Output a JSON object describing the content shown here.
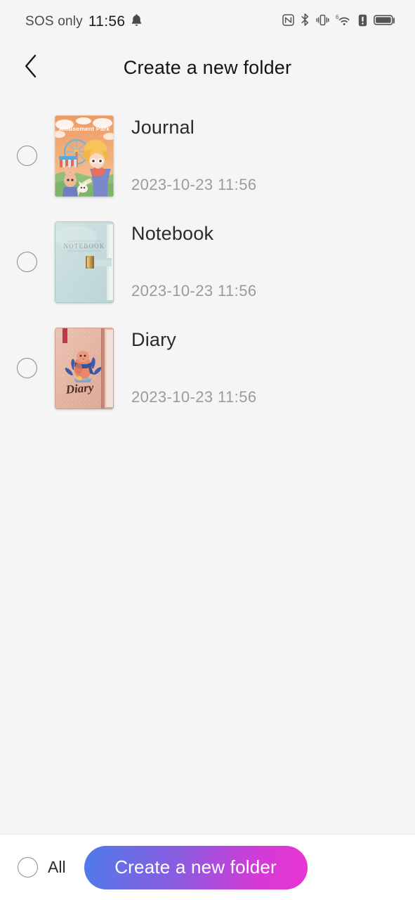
{
  "statusbar": {
    "carrier": "SOS only",
    "time": "11:56",
    "icons_left": [
      "bell-icon"
    ],
    "icons_right": [
      "nfc-icon",
      "bluetooth-icon",
      "vibrate-icon",
      "wifi-6-icon",
      "alert-icon",
      "battery-icon"
    ],
    "wifi_generation": "6"
  },
  "header": {
    "back_icon": "chevron-left-icon",
    "title": "Create a new folder"
  },
  "list": {
    "items": [
      {
        "title": "Journal",
        "date": "2023-10-23 11:56",
        "selected": false,
        "cover": {
          "name": "amusement-park-cover",
          "caption": "Amusement Park",
          "sky": "#f0a06a",
          "ground": "#8fc07a",
          "accent": "#f6c45a"
        }
      },
      {
        "title": "Notebook",
        "date": "2023-10-23 11:56",
        "selected": false,
        "cover": {
          "name": "mint-notebook-cover",
          "caption": "NOTEBOOK",
          "base": "#c6dbdd",
          "clasp": "#b08a3e"
        }
      },
      {
        "title": "Diary",
        "date": "2023-10-23 11:56",
        "selected": false,
        "cover": {
          "name": "rose-diary-cover",
          "caption": "Diary",
          "base": "#e5b6a6",
          "ribbon": "#c0394a",
          "band": "#c58b78"
        }
      }
    ]
  },
  "bottombar": {
    "all_label": "All",
    "all_selected": false,
    "cta_label": "Create a new folder",
    "cta_gradient_from": "#4f7bea",
    "cta_gradient_to": "#ea34d2"
  },
  "theme": {
    "page_background": "#f5f5f5",
    "bar_background": "#ffffff",
    "title_color": "#141414",
    "date_color": "#9b9b9b"
  }
}
